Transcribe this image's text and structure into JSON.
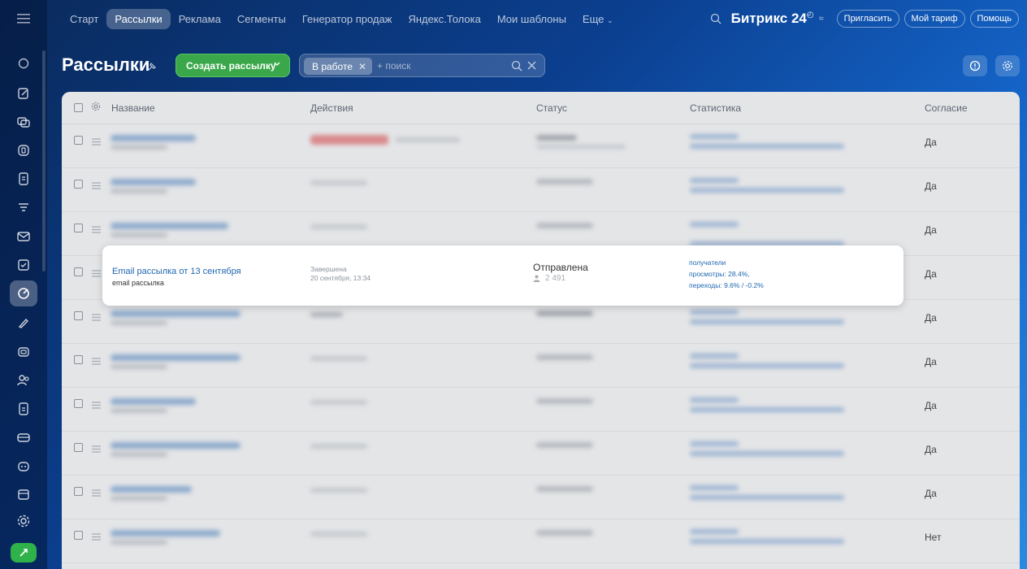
{
  "topnav": {
    "items": [
      "Старт",
      "Рассылки",
      "Реклама",
      "Сегменты",
      "Генератор продаж",
      "Яндекс.Толока",
      "Мои шаблоны",
      "Еще"
    ],
    "active_index": 1,
    "brand": "Битрикс",
    "brand_num": "24",
    "invite": "Пригласить",
    "tariff": "Мой тариф",
    "help": "Помощь"
  },
  "page": {
    "title": "Рассылки",
    "create_button": "Создать рассылку",
    "filter_chip": "В работе",
    "search_placeholder": "+ поиск"
  },
  "table": {
    "columns": [
      "Название",
      "Действия",
      "Статус",
      "Статистика",
      "Согласие"
    ],
    "consent_values": [
      "Да",
      "Да",
      "Да",
      "Да",
      "Да",
      "Да",
      "Да",
      "Да",
      "Да",
      "Нет"
    ]
  },
  "highlighted_row": {
    "name": "Email рассылка от 13 сентября",
    "subtitle": "email рассылка",
    "action_state": "Завершена",
    "action_date": "20 сентября, 13:34",
    "status": "Отправлена",
    "recipients_count": "2 491",
    "stats": [
      "получатели",
      "просмотры: 28.4%,",
      "переходы: 9.6% / -0.2%"
    ]
  },
  "colors": {
    "accent_green": "#3aa84a",
    "link_blue": "#2067b0"
  }
}
